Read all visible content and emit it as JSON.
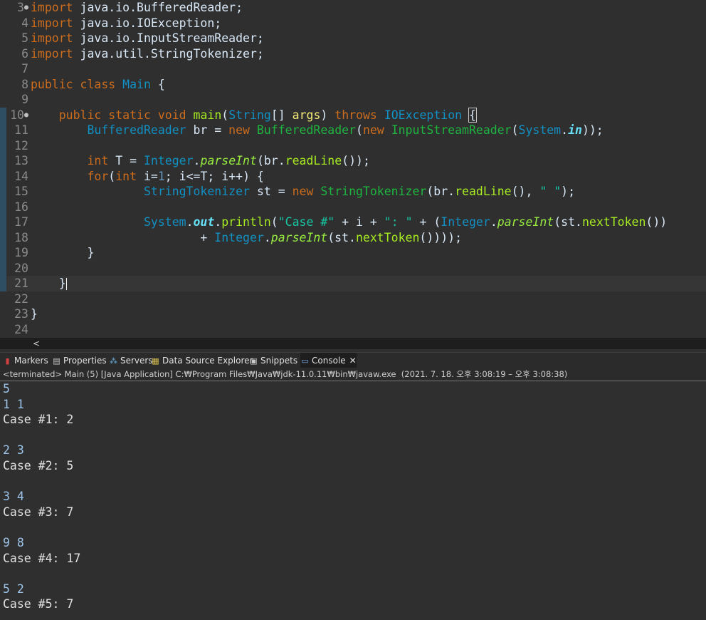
{
  "editor": {
    "lines": [
      {
        "n": "3",
        "fold": true,
        "hl": false,
        "change": false,
        "segs": [
          {
            "t": "import",
            "c": "kw"
          },
          {
            "t": " java.io.BufferedReader;",
            "c": "pln"
          }
        ]
      },
      {
        "n": "4",
        "segs": [
          {
            "t": "import",
            "c": "kw"
          },
          {
            "t": " java.io.IOException;",
            "c": "pln"
          }
        ]
      },
      {
        "n": "5",
        "segs": [
          {
            "t": "import",
            "c": "kw"
          },
          {
            "t": " java.io.InputStreamReader;",
            "c": "pln"
          }
        ]
      },
      {
        "n": "6",
        "segs": [
          {
            "t": "import",
            "c": "kw"
          },
          {
            "t": " java.util.StringTokenizer;",
            "c": "pln"
          }
        ]
      },
      {
        "n": "7",
        "segs": []
      },
      {
        "n": "8",
        "segs": [
          {
            "t": "public",
            "c": "kw"
          },
          {
            "t": " ",
            "c": "pln"
          },
          {
            "t": "class",
            "c": "kw"
          },
          {
            "t": " ",
            "c": "pln"
          },
          {
            "t": "Main",
            "c": "ty"
          },
          {
            "t": " {",
            "c": "pln"
          }
        ]
      },
      {
        "n": "9",
        "segs": []
      },
      {
        "n": "10",
        "fold": true,
        "change": true,
        "segs": [
          {
            "t": "    ",
            "c": "pln"
          },
          {
            "t": "public",
            "c": "kw"
          },
          {
            "t": " ",
            "c": "pln"
          },
          {
            "t": "static",
            "c": "kw"
          },
          {
            "t": " ",
            "c": "pln"
          },
          {
            "t": "void",
            "c": "kw"
          },
          {
            "t": " ",
            "c": "pln"
          },
          {
            "t": "main",
            "c": "mth"
          },
          {
            "t": "(",
            "c": "pln"
          },
          {
            "t": "String",
            "c": "ty"
          },
          {
            "t": "[] ",
            "c": "pln"
          },
          {
            "t": "args",
            "c": "var"
          },
          {
            "t": ") ",
            "c": "pln"
          },
          {
            "t": "throws",
            "c": "kw"
          },
          {
            "t": " ",
            "c": "pln"
          },
          {
            "t": "IOException",
            "c": "ty"
          },
          {
            "t": " ",
            "c": "pln"
          },
          {
            "t": "{",
            "c": "pln",
            "b": true
          }
        ]
      },
      {
        "n": "11",
        "change": true,
        "segs": [
          {
            "t": "        ",
            "c": "pln"
          },
          {
            "t": "BufferedReader",
            "c": "ty"
          },
          {
            "t": " br = ",
            "c": "pln"
          },
          {
            "t": "new",
            "c": "kw"
          },
          {
            "t": " ",
            "c": "pln"
          },
          {
            "t": "BufferedReader",
            "c": "cls"
          },
          {
            "t": "(",
            "c": "pln"
          },
          {
            "t": "new",
            "c": "kw"
          },
          {
            "t": " ",
            "c": "pln"
          },
          {
            "t": "InputStreamReader",
            "c": "cls"
          },
          {
            "t": "(",
            "c": "pln"
          },
          {
            "t": "System",
            "c": "ty"
          },
          {
            "t": ".",
            "c": "pln"
          },
          {
            "t": "in",
            "c": "fld"
          },
          {
            "t": "));",
            "c": "pln"
          }
        ]
      },
      {
        "n": "12",
        "change": true,
        "segs": []
      },
      {
        "n": "13",
        "change": true,
        "segs": [
          {
            "t": "        ",
            "c": "pln"
          },
          {
            "t": "int",
            "c": "kw"
          },
          {
            "t": " T = ",
            "c": "pln"
          },
          {
            "t": "Integer",
            "c": "ty"
          },
          {
            "t": ".",
            "c": "pln"
          },
          {
            "t": "parseInt",
            "c": "smth"
          },
          {
            "t": "(br.",
            "c": "pln"
          },
          {
            "t": "readLine",
            "c": "mth"
          },
          {
            "t": "());",
            "c": "pln"
          }
        ]
      },
      {
        "n": "14",
        "change": true,
        "segs": [
          {
            "t": "        ",
            "c": "pln"
          },
          {
            "t": "for",
            "c": "kw"
          },
          {
            "t": "(",
            "c": "pln"
          },
          {
            "t": "int",
            "c": "kw"
          },
          {
            "t": " i=",
            "c": "pln"
          },
          {
            "t": "1",
            "c": "num"
          },
          {
            "t": "; i<=T; i++) {",
            "c": "pln"
          }
        ]
      },
      {
        "n": "15",
        "change": true,
        "segs": [
          {
            "t": "                ",
            "c": "pln"
          },
          {
            "t": "StringTokenizer",
            "c": "ty"
          },
          {
            "t": " st = ",
            "c": "pln"
          },
          {
            "t": "new",
            "c": "kw"
          },
          {
            "t": " ",
            "c": "pln"
          },
          {
            "t": "StringTokenizer",
            "c": "cls"
          },
          {
            "t": "(br.",
            "c": "pln"
          },
          {
            "t": "readLine",
            "c": "mth"
          },
          {
            "t": "(), ",
            "c": "pln"
          },
          {
            "t": "\" \"",
            "c": "str"
          },
          {
            "t": ");",
            "c": "pln"
          }
        ]
      },
      {
        "n": "16",
        "change": true,
        "segs": []
      },
      {
        "n": "17",
        "change": true,
        "segs": [
          {
            "t": "                ",
            "c": "pln"
          },
          {
            "t": "System",
            "c": "ty"
          },
          {
            "t": ".",
            "c": "pln"
          },
          {
            "t": "out",
            "c": "fld"
          },
          {
            "t": ".",
            "c": "pln"
          },
          {
            "t": "println",
            "c": "mth"
          },
          {
            "t": "(",
            "c": "pln"
          },
          {
            "t": "\"Case #\"",
            "c": "str"
          },
          {
            "t": " + i + ",
            "c": "pln"
          },
          {
            "t": "\": \"",
            "c": "str"
          },
          {
            "t": " + (",
            "c": "pln"
          },
          {
            "t": "Integer",
            "c": "ty"
          },
          {
            "t": ".",
            "c": "pln"
          },
          {
            "t": "parseInt",
            "c": "smth"
          },
          {
            "t": "(st.",
            "c": "pln"
          },
          {
            "t": "nextToken",
            "c": "mth"
          },
          {
            "t": "())",
            "c": "pln"
          }
        ]
      },
      {
        "n": "18",
        "change": true,
        "segs": [
          {
            "t": "                        + ",
            "c": "pln"
          },
          {
            "t": "Integer",
            "c": "ty"
          },
          {
            "t": ".",
            "c": "pln"
          },
          {
            "t": "parseInt",
            "c": "smth"
          },
          {
            "t": "(st.",
            "c": "pln"
          },
          {
            "t": "nextToken",
            "c": "mth"
          },
          {
            "t": "())));",
            "c": "pln"
          }
        ]
      },
      {
        "n": "19",
        "change": true,
        "segs": [
          {
            "t": "        }",
            "c": "pln"
          }
        ]
      },
      {
        "n": "20",
        "change": true,
        "segs": []
      },
      {
        "n": "21",
        "change": true,
        "hl": true,
        "caret": true,
        "segs": [
          {
            "t": "    }",
            "c": "pln"
          }
        ]
      },
      {
        "n": "22",
        "segs": []
      },
      {
        "n": "23",
        "segs": [
          {
            "t": "}",
            "c": "pln"
          }
        ]
      },
      {
        "n": "24",
        "segs": []
      }
    ]
  },
  "scroll": {
    "left_arrow": "<"
  },
  "views": {
    "tabs": [
      {
        "label": "Markers",
        "icon": "markers-icon",
        "glyph": "▮",
        "color": "#d04040"
      },
      {
        "label": "Properties",
        "icon": "properties-icon",
        "glyph": "▤",
        "color": "#c8c8c8"
      },
      {
        "label": "Servers",
        "icon": "servers-icon",
        "glyph": "⁂",
        "color": "#6ab0e0"
      },
      {
        "label": "Data Source Explorer",
        "icon": "data-source-icon",
        "glyph": "▦",
        "color": "#d8c050"
      },
      {
        "label": "Snippets",
        "icon": "snippets-icon",
        "glyph": "▣",
        "color": "#c8c8c8"
      },
      {
        "label": "Console",
        "icon": "console-icon",
        "glyph": "▭",
        "color": "#7aa8e0",
        "active": true
      }
    ],
    "close_glyph": "✕"
  },
  "status": "<terminated> Main (5) [Java Application] C:₩Program Files₩Java₩jdk-11.0.11₩bin₩javaw.exe  (2021. 7. 18. 오후 3:08:19 – 오후 3:08:38)",
  "console": {
    "lines": [
      {
        "t": "5",
        "c": "cin"
      },
      {
        "t": "1 1",
        "c": "cin"
      },
      {
        "t": "Case #1: 2",
        "c": "cout"
      },
      {
        "t": "",
        "c": "cout"
      },
      {
        "t": "2 3",
        "c": "cin"
      },
      {
        "t": "Case #2: 5",
        "c": "cout"
      },
      {
        "t": "",
        "c": "cout"
      },
      {
        "t": "3 4",
        "c": "cin"
      },
      {
        "t": "Case #3: 7",
        "c": "cout"
      },
      {
        "t": "",
        "c": "cout"
      },
      {
        "t": "9 8",
        "c": "cin"
      },
      {
        "t": "Case #4: 17",
        "c": "cout"
      },
      {
        "t": "",
        "c": "cout"
      },
      {
        "t": "5 2",
        "c": "cin"
      },
      {
        "t": "Case #5: 7",
        "c": "cout"
      }
    ]
  }
}
